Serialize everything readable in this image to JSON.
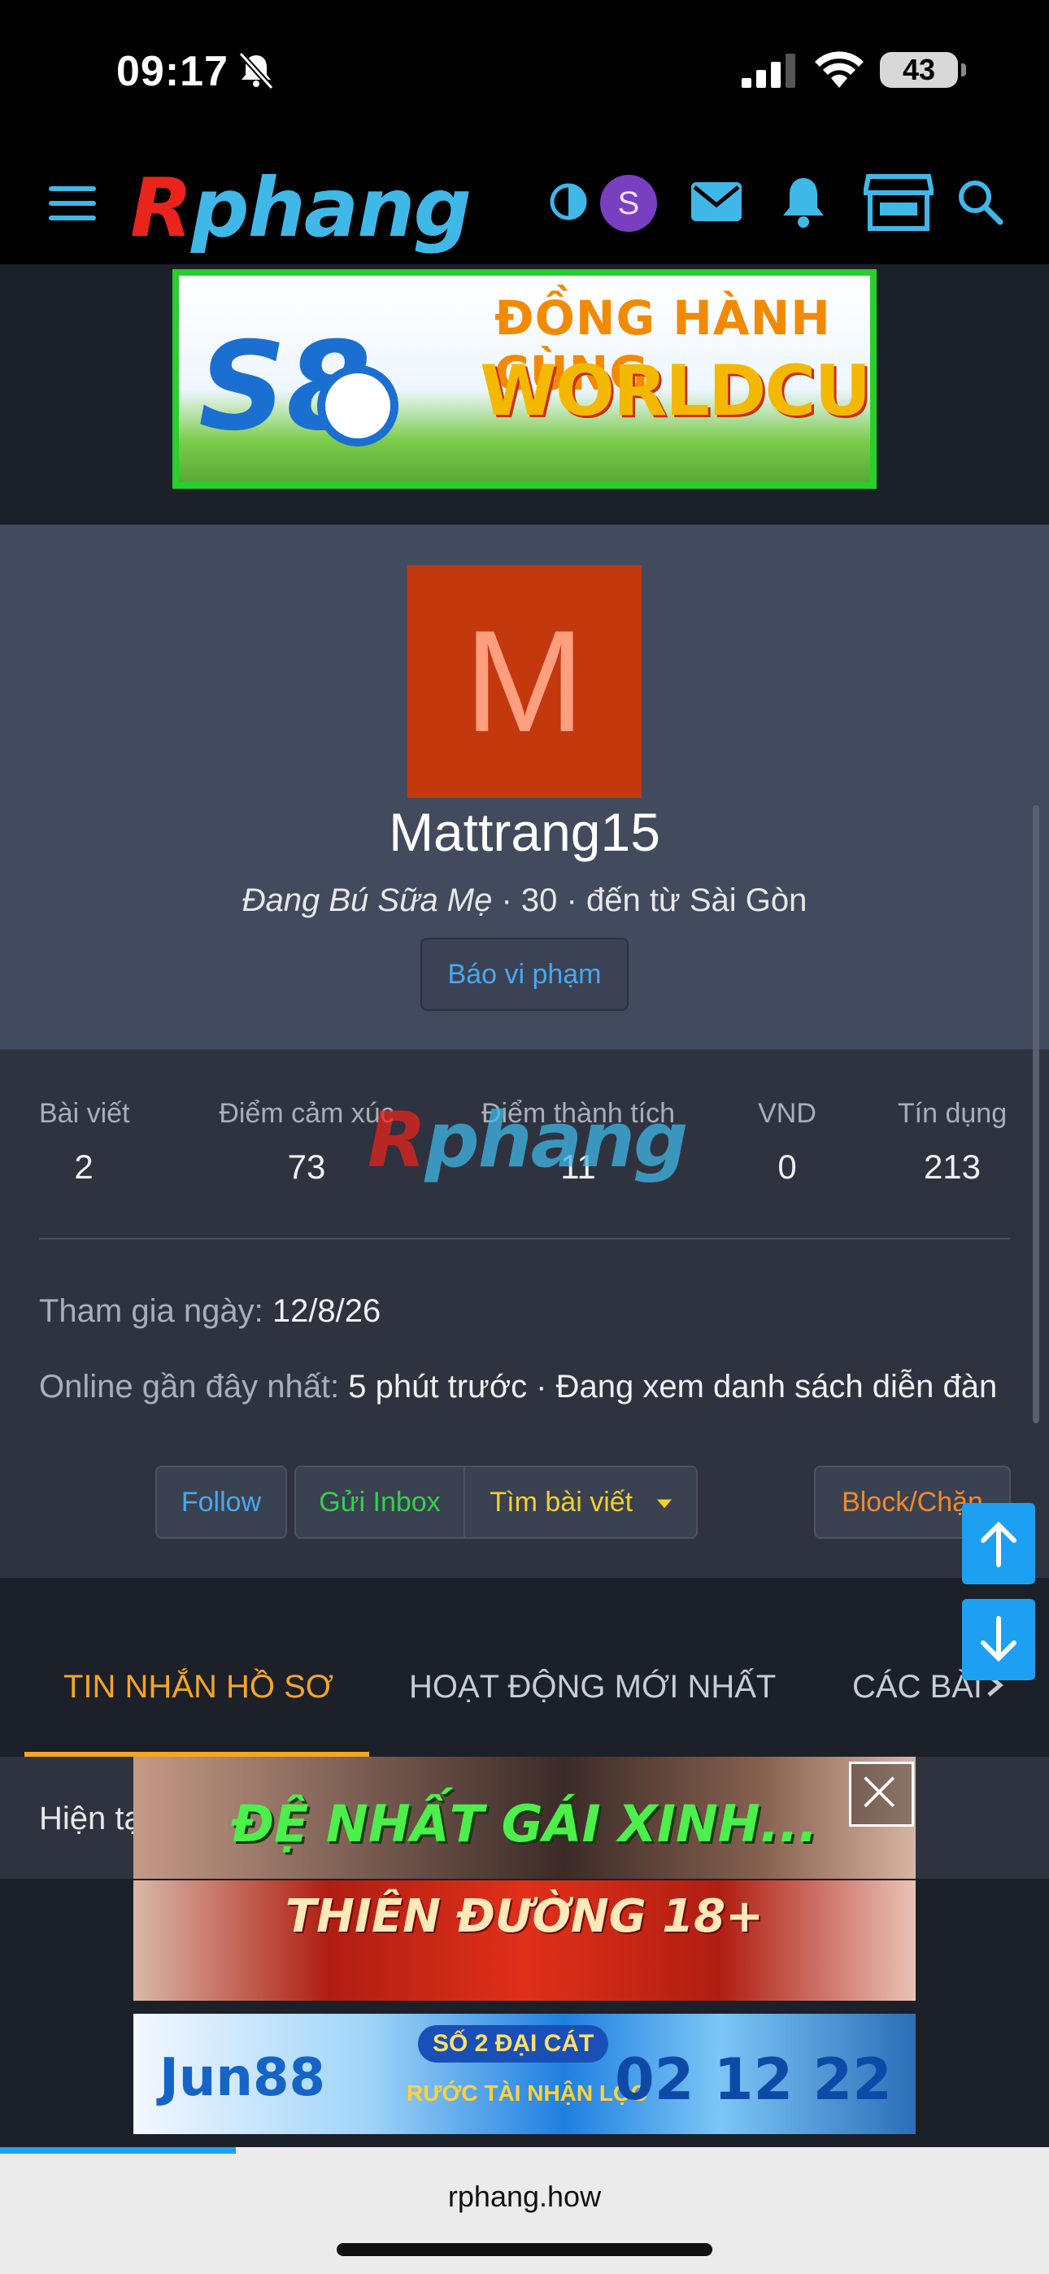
{
  "status_bar": {
    "time": "09:17",
    "battery": "43"
  },
  "nav": {
    "logo_first": "R",
    "logo_rest": "phang",
    "user_initial": "S"
  },
  "banner": {
    "brand": "S8",
    "line1": "ĐỒNG HÀNH CÙNG",
    "line2": "WORLDCUP"
  },
  "profile": {
    "avatar_letter": "M",
    "username": "Mattrang15",
    "user_title": "Đang Bú Sữa Mẹ",
    "age": "30",
    "location": "đến từ Sài Gòn",
    "separator": " · ",
    "report_label": "Báo vi phạm"
  },
  "stats": {
    "watermark_first": "R",
    "watermark_rest": "phang",
    "items": [
      {
        "label": "Bài viết",
        "value": "2"
      },
      {
        "label": "Điểm cảm xúc",
        "value": "73"
      },
      {
        "label": "Điểm thành tích",
        "value": "11"
      },
      {
        "label": "VND",
        "value": "0"
      },
      {
        "label": "Tín dụng",
        "value": "213"
      }
    ],
    "joined_label": "Tham gia ngày:",
    "joined_value": "12/8/26",
    "online_label": "Online gần đây nhất:",
    "online_value": "5 phút trước · Đang xem danh sách diễn đàn"
  },
  "actions": {
    "follow": "Follow",
    "inbox": "Gửi Inbox",
    "find_posts": "Tìm bài viết",
    "block": "Block/Chặn"
  },
  "tabs": {
    "items": [
      {
        "label": "TIN NHẮN HỒ SƠ"
      },
      {
        "label": "HOẠT ĐỘNG MỚI NHẤT"
      },
      {
        "label": "CÁC BÀI"
      }
    ]
  },
  "content": {
    "text": "Hiện tại"
  },
  "ads": {
    "ad1": "ĐỆ NHẤT GÁI XINH...",
    "ad2": "THIÊN ĐƯỜNG 18+",
    "ad3_brand": "Jun88",
    "ad3_badge": "SỐ 2 ĐẠI CÁT",
    "ad3_sub": "RƯỚC TÀI NHẬN LỘC",
    "ad3_date": "02 12 22"
  },
  "browser": {
    "url": "rphang.how"
  },
  "colors": {
    "accent_blue": "#1da0f2",
    "tab_active": "#f5a623",
    "follow": "#47a8f0",
    "inbox": "#34d04a",
    "find": "#f2d02a",
    "block": "#f08a2a",
    "avatar_bg": "#c4380e"
  }
}
